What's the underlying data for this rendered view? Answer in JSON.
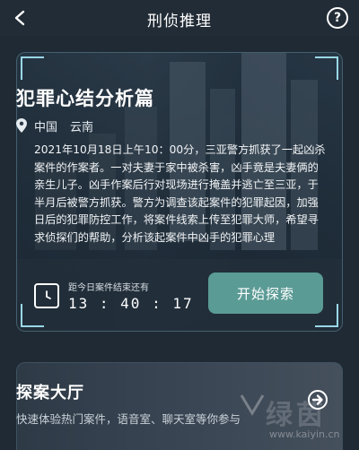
{
  "header": {
    "title": "刑侦推理",
    "back_icon": "chevron-left-icon",
    "help_icon": "question-circle-icon",
    "help_glyph": "?"
  },
  "case": {
    "title": "犯罪心结分析篇",
    "location_icon": "location-pin-icon",
    "country": "中国",
    "city": "云南",
    "description": "2021年10月18日上午10：00分，三亚警方抓获了一起凶杀案件的作案者。一对夫妻于家中被杀害，凶手竟是夫妻俩的亲生儿子。凶手作案后行对现场进行掩盖并逃亡至三亚，于半月后被警方抓获。警方为调查该起案件的犯罪起因，加强日后的犯罪防控工作，将案件线索上传至犯罪大师，希望寻求侦探们的帮助，分析该起案件中凶手的犯罪心理",
    "timer_icon": "clock-icon",
    "timer_label": "距今日案件结束还有",
    "timer_value": "13 : 40 : 17",
    "start_button": "开始探索"
  },
  "hall": {
    "title": "探案大厅",
    "description": "快速体验热门案件，语音室、聊天室等你参与",
    "arrow_icon": "arrow-right-circle-icon"
  },
  "watermark": {
    "text": "绿茵",
    "url": "www.kaiyin.cn"
  },
  "colors": {
    "background": "#1f2a34",
    "accent_button": "#5b9b95",
    "frame_corner": "#9ad7e6"
  }
}
